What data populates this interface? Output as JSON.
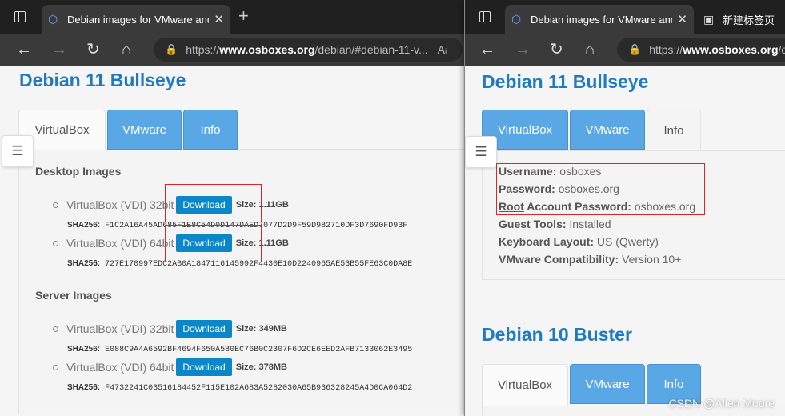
{
  "left": {
    "tab_title": "Debian images for VMware and V",
    "url_scheme": "https://",
    "url_host": "www.osboxes.org",
    "url_path": "/debian/#debian-11-v...",
    "reader_icon": "Aᵢ",
    "heading": "Debian 11 Bullseye",
    "tabs": [
      "VirtualBox",
      "VMware",
      "Info"
    ],
    "desktop_title": "Desktop Images",
    "server_title": "Server Images",
    "download_label": "Download",
    "size_label": "Size:",
    "sha_label": "SHA256:",
    "desktop": [
      {
        "name": "VirtualBox (VDI) 32bit",
        "size": "1.11GB",
        "sha": "F1C2A16A45AD685F1E8C54D0D147DAED7077D2D9F59D982710DF3D7690FD93F"
      },
      {
        "name": "VirtualBox (VDI) 64bit",
        "size": "1.11GB",
        "sha": "727E170997EDC2AB0A1847116145992F4430E10D2240965AE53B55FE63C0DA8E"
      }
    ],
    "server": [
      {
        "name": "VirtualBox (VDI) 32bit",
        "size": "349MB",
        "sha": "E088C9A4A6592BF4694F650A580EC76B0C2307F6D2CE6EED2AFB7133062E3495"
      },
      {
        "name": "VirtualBox (VDI) 64bit",
        "size": "378MB",
        "sha": "F4732241C03516184452F115E102A683A5282030A65B936328245A4D0CA064D2"
      }
    ]
  },
  "right": {
    "tab_title": "Debian images for VMware and V",
    "tab2_title": "新建标签页",
    "url_scheme": "https://",
    "url_host": "www.osboxes.org",
    "url_path": "/d",
    "heading": "Debian 11 Bullseye",
    "tabs": [
      "VirtualBox",
      "VMware",
      "Info"
    ],
    "info": {
      "username_label": "Username:",
      "username": "osboxes",
      "password_label": "Password:",
      "password": "osboxes.org",
      "root_word": "Root",
      "root_label": " Account Password:",
      "root_password": "osboxes.org",
      "guest_label": "Guest Tools:",
      "guest": "Installed",
      "keyboard_label": "Keyboard Layout:",
      "keyboard": "US (Qwerty)",
      "compat_label": "VMware Compatibility:",
      "compat": "Version 10+"
    },
    "heading2": "Debian 10 Buster",
    "tabs2": [
      "VirtualBox",
      "VMware",
      "Info"
    ]
  },
  "watermark": "CSDN @Allen Moore",
  "colors": {
    "heading": "#1f7ac2",
    "tab_blue": "#5aa7e5",
    "download": "#0b87c9",
    "highlight": "#d9262c"
  }
}
